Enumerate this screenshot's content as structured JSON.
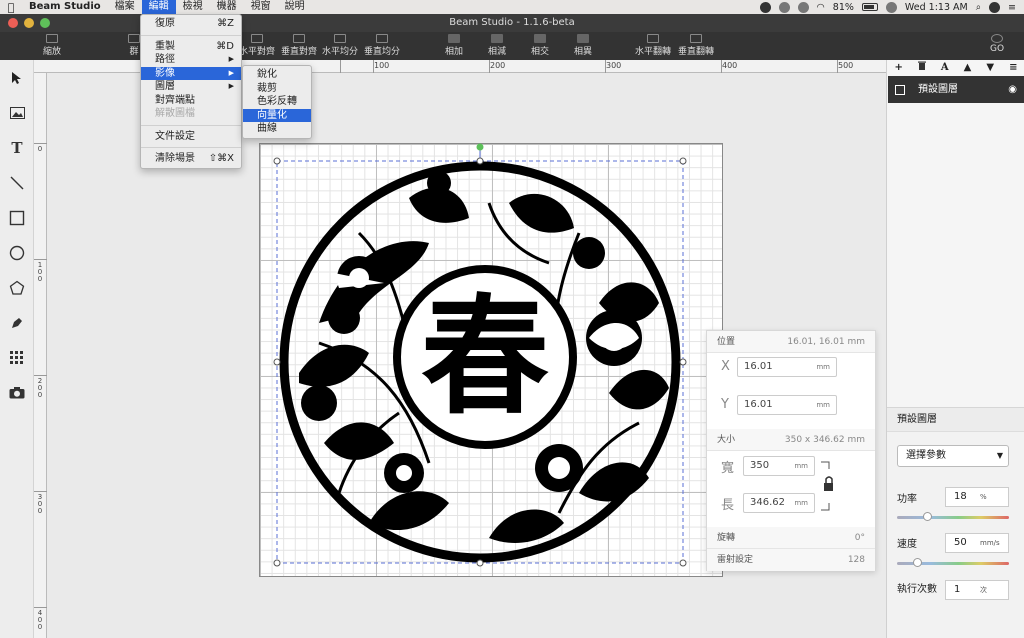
{
  "menubar": {
    "app": "Beam Studio",
    "items": [
      "檔案",
      "編輯",
      "檢視",
      "機器",
      "視窗",
      "說明"
    ],
    "active": "編輯",
    "battery": "81%",
    "clock": "Wed 1:13 AM"
  },
  "window": {
    "title": "Beam Studio - 1.1.6-beta"
  },
  "toolbar": {
    "buttons": [
      "縮放",
      "群",
      "水平對齊",
      "垂直對齊",
      "水平均分",
      "垂直均分",
      "相加",
      "相減",
      "相交",
      "相異",
      "水平翻轉",
      "垂直翻轉",
      "GO"
    ]
  },
  "left_tools": [
    "cursor-icon",
    "image-icon",
    "text-icon",
    "line-icon",
    "rectangle-icon",
    "ellipse-icon",
    "polygon-icon",
    "pen-icon",
    "grid-icon",
    "camera-icon"
  ],
  "ruler": {
    "top": [
      "100",
      "200",
      "300",
      "400",
      "500"
    ],
    "left": [
      "0",
      "100",
      "200",
      "300",
      "400"
    ]
  },
  "edit_menu": {
    "items": [
      {
        "label": "復原",
        "shortcut": "⌘Z"
      },
      {
        "label": "重製",
        "shortcut": "⌘D"
      },
      {
        "label": "路徑",
        "shortcut": "▶"
      },
      {
        "label": "影像",
        "shortcut": "▶"
      },
      {
        "label": "圖層",
        "shortcut": "▶"
      },
      {
        "label": "對齊端點",
        "shortcut": ""
      },
      {
        "label": "解散圖檔",
        "shortcut": ""
      },
      {
        "label": "文件設定",
        "shortcut": ""
      },
      {
        "label": "清除場景",
        "shortcut": "⇧⌘X"
      }
    ]
  },
  "image_submenu": {
    "items": [
      "銳化",
      "裁剪",
      "色彩反轉",
      "向量化",
      "曲線"
    ],
    "highlighted": "向量化"
  },
  "artwork": {
    "character": "春"
  },
  "object_panel": {
    "position_label": "位置",
    "position_value": "16.01, 16.01 mm",
    "x_label": "X",
    "x_value": "16.01",
    "y_label": "Y",
    "y_value": "16.01",
    "unit": "mm",
    "size_label": "大小",
    "size_value": "350 x 346.62 mm",
    "width_label": "寬",
    "width_value": "350",
    "height_label": "長",
    "height_value": "346.62",
    "rotation_label": "旋轉",
    "rotation_value": "0°",
    "laser_label": "雷射設定",
    "laser_value": "128"
  },
  "right_panel": {
    "icons": [
      "+",
      "🗑",
      "A",
      "▲",
      "▼",
      "≡"
    ],
    "layer_name": "預設圖層",
    "params_title": "預設圖層",
    "select_label": "選擇參數",
    "power_label": "功率",
    "power_value": "18",
    "power_unit": "%",
    "speed_label": "速度",
    "speed_value": "50",
    "speed_unit": "mm/s",
    "repeat_label": "執行次數",
    "repeat_value": "1",
    "repeat_unit": "次"
  }
}
